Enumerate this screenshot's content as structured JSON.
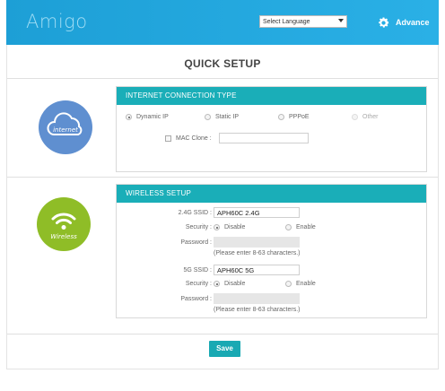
{
  "header": {
    "logo_text": "Amigo",
    "language_select": "Select Language",
    "advance_label": "Advance"
  },
  "page_title": "QUICK SETUP",
  "internet": {
    "icon_label": "internet",
    "panel_title": "INTERNET CONNECTION TYPE",
    "options": [
      "Dynamic IP",
      "Static IP",
      "PPPoE",
      "Other"
    ],
    "selected": "Dynamic IP",
    "mac_clone_label": "MAC Clone :",
    "mac_clone_value": ""
  },
  "wireless": {
    "icon_label": "Wireless",
    "panel_title": "WIRELESS SETUP",
    "band_24": {
      "ssid_label": "2.4G SSID :",
      "ssid_value": "APH60C 2.4G",
      "security_label": "Security :",
      "security_options": [
        "Disable",
        "Enable"
      ],
      "security_selected": "Disable",
      "password_label": "Password :",
      "password_hint": "(Please enter 8-63 characters.)"
    },
    "band_5": {
      "ssid_label": "5G SSID :",
      "ssid_value": "APH60C 5G",
      "security_label": "Security :",
      "security_options": [
        "Disable",
        "Enable"
      ],
      "security_selected": "Disable",
      "password_label": "Password :",
      "password_hint": "(Please enter 8-63 characters.)"
    }
  },
  "save_label": "Save",
  "colors": {
    "header_blue": "#1d9fd6",
    "teal_accent": "#1aaeb8",
    "internet_circle": "#5f8fd0",
    "wireless_circle": "#8fbd27"
  }
}
